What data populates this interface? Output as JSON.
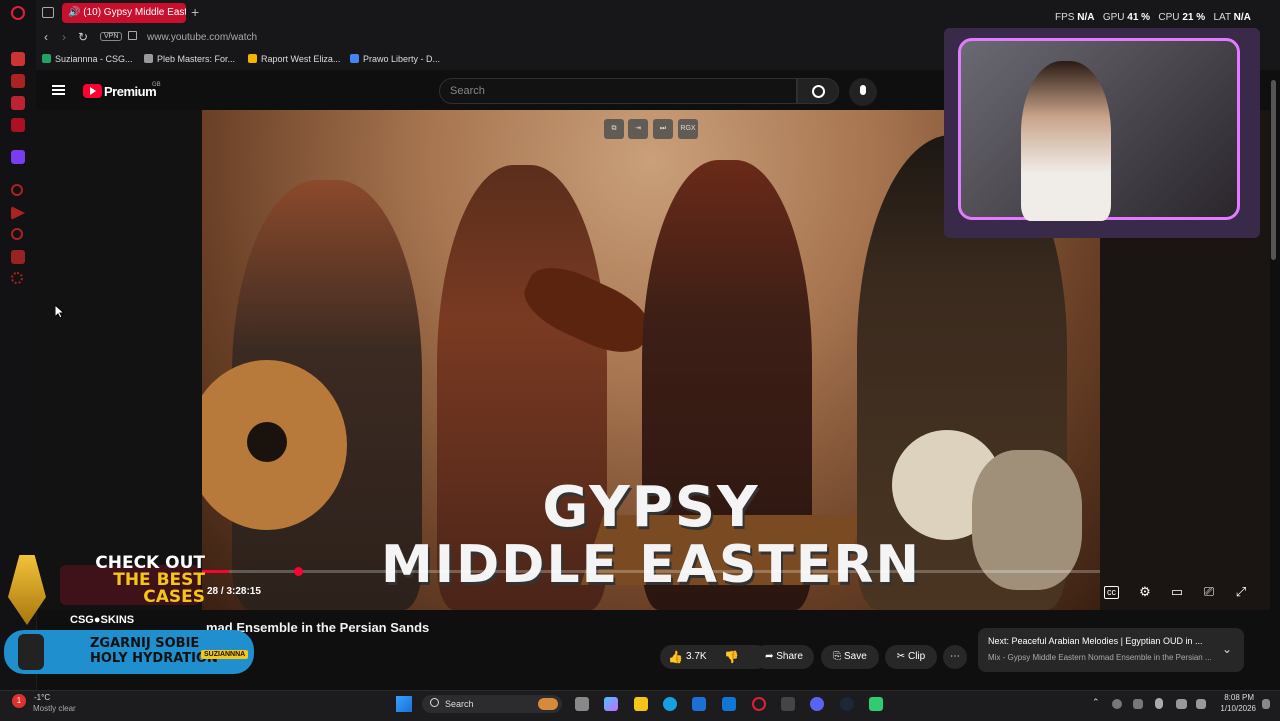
{
  "browser": {
    "tab_title": "(10) Gypsy Middle East",
    "url": "www.youtube.com/watch",
    "vpn_label": "VPN",
    "bookmarks": [
      "Suziannna - CSG...",
      "Pleb Masters: For...",
      "Raport West Eliza...",
      "Prawo Liberty - D..."
    ]
  },
  "overlay_stats": {
    "fps_label": "FPS",
    "fps_value": "N/A",
    "gpu_label": "GPU",
    "gpu_value": "41 %",
    "cpu_label": "CPU",
    "cpu_value": "21 %",
    "lat_label": "LAT",
    "lat_value": "N/A"
  },
  "youtube": {
    "brand": "Premium",
    "brand_sup": "GB",
    "search_placeholder": "Search",
    "player_top_buttons": [
      "",
      "",
      "",
      "RGX"
    ],
    "thumbnail_line1": "GYPSY",
    "thumbnail_line2": "MIDDLE EASTERN",
    "time": "28 / 3:28:15",
    "progress_fraction": 0.03,
    "video_title": "mad Ensemble in the Persian Sands",
    "like_count": "3.7K",
    "share_label": "Share",
    "save_label": "Save",
    "clip_label": "Clip",
    "next_title": "Next: Peaceful Arabian Melodies | Egyptian OUD in ...",
    "next_subtitle": "Mix - Gypsy Middle Eastern Nomad Ensemble in the Persian ..."
  },
  "ad": {
    "line1": "CHECK OUT",
    "line2": "THE BEST",
    "line3": "CASES",
    "brand": "CSG●SKINS",
    "promo_line1": "ZGARNIJ SOBIE",
    "promo_line2": "HOLY HYDRATION",
    "promo_tag": "SUZIANNNA"
  },
  "taskbar": {
    "weather_temp": "-1°C",
    "weather_desc": "Mostly clear",
    "search": "Search",
    "time": "8:08 PM",
    "date": "1/10/2026",
    "notification_badge": "1"
  },
  "colors": {
    "yt_red": "#ff0033",
    "opera_red": "#c8102e",
    "webcam_frame": "#e27bff"
  }
}
